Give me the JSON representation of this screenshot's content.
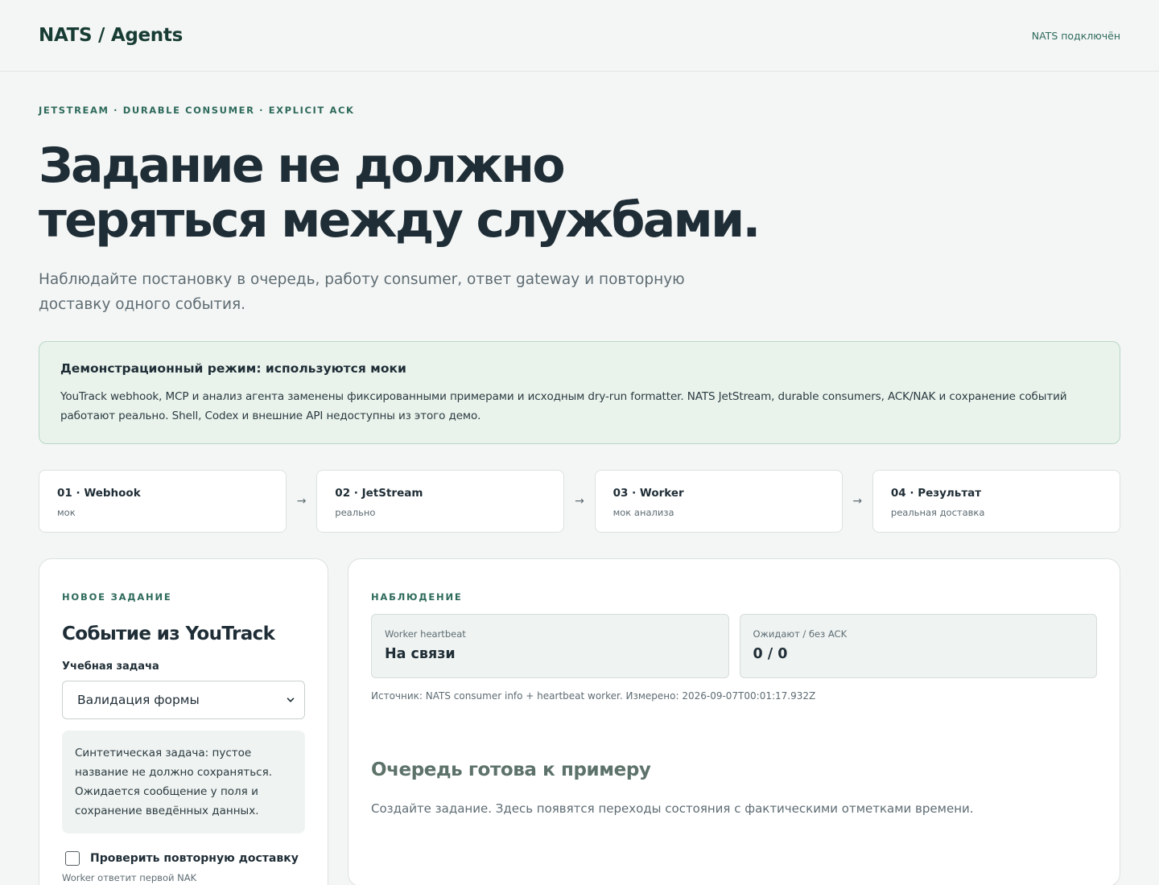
{
  "header": {
    "brand": "NATS / Agents",
    "status": "NATS подключён"
  },
  "hero": {
    "eyebrow": "JETSTREAM · DURABLE CONSUMER · EXPLICIT ACK",
    "title": "Задание не должно теряться между службами.",
    "subtitle": "Наблюдайте постановку в очередь, работу consumer, ответ gateway и повторную доставку одного события."
  },
  "notice": {
    "title": "Демонстрационный режим: используются моки",
    "text": "YouTrack webhook, MCP и анализ агента заменены фиксированными примерами и исходным dry-run formatter. NATS JetStream, durable consumers, ACK/NAK и сохранение событий работают реально. Shell, Codex и внешние API недоступны из этого демо."
  },
  "pipeline": {
    "arrow": "→",
    "steps": [
      {
        "title": "01 · Webhook",
        "sub": "мок"
      },
      {
        "title": "02 · JetStream",
        "sub": "реально"
      },
      {
        "title": "03 · Worker",
        "sub": "мок анализа"
      },
      {
        "title": "04 · Результат",
        "sub": "реальная доставка"
      }
    ]
  },
  "new_task": {
    "section_label": "НОВОЕ ЗАДАНИЕ",
    "title": "Событие из YouTrack",
    "field_label": "Учебная задача",
    "selected_option": "Валидация формы",
    "description": "Синтетическая задача: пустое название не должно сохраняться. Ожидается сообщение у поля и сохранение введённых данных.",
    "redelivery_label": "Проверить повторную доставку",
    "redelivery_checked": false,
    "hint": "Worker ответит первой NAK"
  },
  "observation": {
    "section_label": "НАБЛЮДЕНИЕ",
    "metrics": [
      {
        "label": "Worker heartbeat",
        "value": "На связи"
      },
      {
        "label": "Ожидают / без ACK",
        "value": "0 / 0"
      }
    ],
    "source": "Источник: NATS consumer info + heartbeat worker. Измерено: 2026-09-07T00:01:17.932Z",
    "empty_title": "Очередь готова к примеру",
    "empty_sub": "Создайте задание. Здесь появятся переходы состояния с фактическими отметками времени."
  }
}
